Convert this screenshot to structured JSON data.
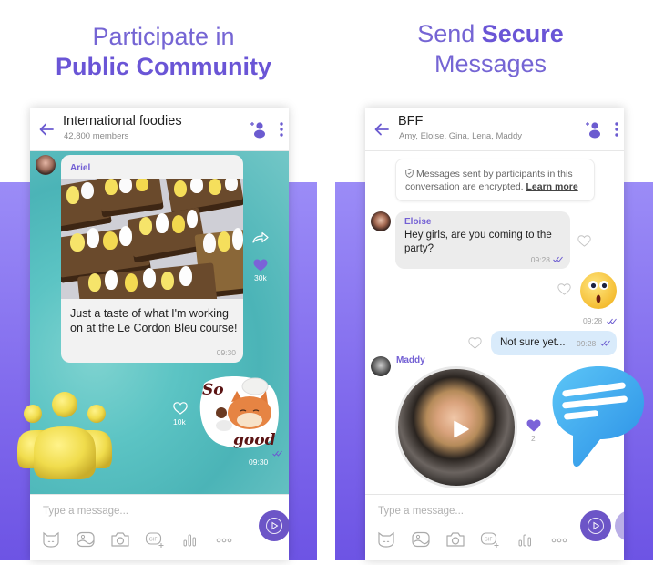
{
  "left_panel": {
    "headline_line1": "Participate in",
    "headline_line2": "Public Community",
    "chat": {
      "title": "International foodies",
      "subtitle": "42,800 members",
      "messages": [
        {
          "sender": "Ariel",
          "type": "photo",
          "text": "Just a taste of what I'm working on at the Le Cordon Bleu course!",
          "time": "09:30",
          "likes": "30k",
          "liked": true
        },
        {
          "type": "sticker",
          "sticker_text_top": "So",
          "sticker_text_bottom": "good",
          "time": "09:30",
          "likes": "10k",
          "liked": false
        }
      ],
      "composer": {
        "placeholder": "Type a message...",
        "tools": [
          "sticker-icon",
          "gallery-icon",
          "camera-icon",
          "gif-icon",
          "poll-icon",
          "more-options-icon"
        ]
      }
    }
  },
  "right_panel": {
    "headline_line1_light": "Send ",
    "headline_line1_bold": "Secure",
    "headline_line2": "Messages",
    "chat": {
      "title": "BFF",
      "subtitle": "Amy, Eloise, Gina, Lena, Maddy",
      "encryption_notice": "Messages sent by participants in this conversation are encrypted.",
      "encryption_link": "Learn more",
      "messages": [
        {
          "sender": "Eloise",
          "text": "Hey girls, are you coming to the party?",
          "time": "09:28",
          "direction": "incoming"
        },
        {
          "type": "emoji",
          "emoji": "shocked-face",
          "time": "09:28",
          "direction": "outgoing"
        },
        {
          "text": "Not sure yet...",
          "time": "09:28",
          "direction": "outgoing"
        },
        {
          "sender": "Maddy",
          "type": "video-message",
          "likes": "2",
          "liked": true,
          "direction": "incoming"
        }
      ],
      "composer": {
        "placeholder": "Type a message...",
        "tools": [
          "sticker-icon",
          "gallery-icon",
          "camera-icon",
          "gif-icon",
          "poll-icon",
          "more-options-icon"
        ]
      }
    }
  },
  "colors": {
    "brand_purple": "#7360f2",
    "headline": "#6b5bd0",
    "teal": "#5cc4c4",
    "outgoing_bubble": "#d9ebfb"
  }
}
